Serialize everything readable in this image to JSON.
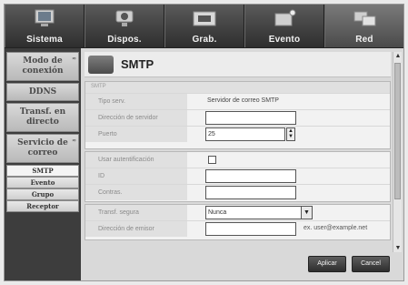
{
  "top_nav": {
    "tabs": [
      {
        "label": "Sistema",
        "icon": "monitor-icon"
      },
      {
        "label": "Dispos.",
        "icon": "camera-icon"
      },
      {
        "label": "Grab.",
        "icon": "recording-icon"
      },
      {
        "label": "Evento",
        "icon": "alarm-icon"
      },
      {
        "label": "Red",
        "icon": "network-icon"
      }
    ],
    "active_tab": "Red"
  },
  "sidebar": {
    "items": [
      {
        "label": "Modo de conexión"
      },
      {
        "label": "DDNS"
      },
      {
        "label": "Transf. en directo"
      },
      {
        "label": "Servicio de correo"
      }
    ],
    "sub_items": [
      {
        "label": "SMTP"
      },
      {
        "label": "Evento"
      },
      {
        "label": "Grupo"
      },
      {
        "label": "Receptor"
      }
    ],
    "active_sub": "SMTP"
  },
  "page": {
    "title": "SMTP",
    "section_label": "SMTP"
  },
  "form": {
    "server_type": {
      "label": "Tipo serv.",
      "value": "Servidor de correo SMTP"
    },
    "server_address": {
      "label": "Dirección de servidor",
      "value": ""
    },
    "port": {
      "label": "Puerto",
      "value": "25"
    },
    "use_auth": {
      "label": "Usar autentificación",
      "checked": false
    },
    "id": {
      "label": "ID",
      "value": ""
    },
    "password": {
      "label": "Contras.",
      "value": ""
    },
    "secure_transfer": {
      "label": "Transf. segura",
      "value": "Nunca"
    },
    "sender_address": {
      "label": "Dirección de emisor",
      "value": "",
      "hint": "ex. user@example.net"
    }
  },
  "buttons": {
    "apply": "Aplicar",
    "cancel": "Cancel"
  },
  "colors": {
    "nav_bg": "#3a3a3a",
    "panel_bg": "#f2f2f2",
    "button_bg": "#3a3a3a"
  }
}
